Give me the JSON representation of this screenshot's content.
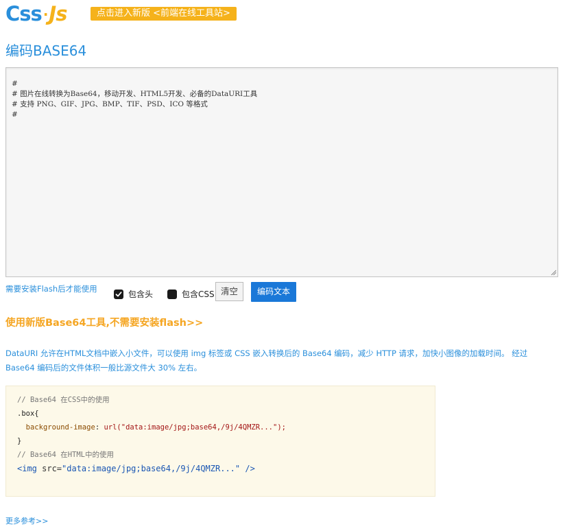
{
  "header": {
    "logo_css": "Css",
    "logo_dot": "·",
    "logo_js": "Js",
    "promo_label": "点击进入新版 <前端在线工具站>"
  },
  "page_title": "编码BASE64",
  "editor": {
    "lines": [
      "#",
      "# 图片在线转换为Base64，移动开发、HTML5开发、必备的DataURI工具",
      "# 支持 PNG、GIF、JPG、BMP、TIF、PSD、ICO 等格式",
      "#"
    ]
  },
  "controls": {
    "flash_note": "需要安装Flash后才能使用",
    "include_header_label": "包含头",
    "include_header_checked": true,
    "include_css_label": "包含CSS",
    "include_css_checked": false,
    "clear_label": "清空",
    "encode_label": "编码文本"
  },
  "new_version_link": "使用新版Base64工具,不需要安装flash>>",
  "description": "DataURI 允许在HTML文档中嵌入小文件，可以使用 img 标签或 CSS 嵌入转换后的 Base64 编码，减少 HTTP 请求，加快小图像的加载时间。 经过 Base64 编码后的文件体积一般比源文件大 30% 左右。",
  "code": {
    "css_comment": "// Base64 在CSS中的使用",
    "selector": ".box{",
    "property": "background-image",
    "property_colon": ": ",
    "value": "url(\"data:image/jpg;base64,/9j/4QMZR...\");",
    "close_brace": "}",
    "html_comment": "// Base64 在HTML中的使用",
    "img_open": "<img",
    "img_attr": " src=",
    "img_value": "\"data:image/jpg;base64,/9j/4QMZR...\"",
    "img_close": " />"
  },
  "more_link": "更多参考>>",
  "colors": {
    "brand_blue": "#2a8fdb",
    "brand_yellow": "#f5b21b",
    "button_blue": "#1a78d8"
  }
}
